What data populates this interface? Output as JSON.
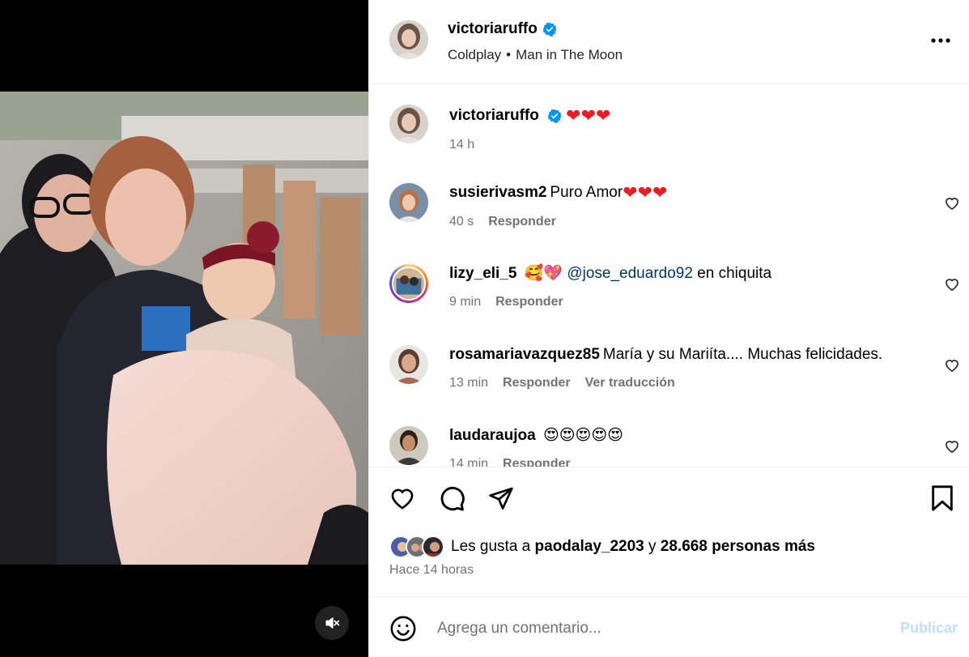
{
  "post": {
    "author": "victoriaruffo",
    "verified": true,
    "audio": {
      "artist": "Coldplay",
      "separator": "•",
      "song": "Man in The Moon"
    },
    "caption": {
      "user": "victoriaruffo",
      "text": "❤❤❤",
      "time": "14 h"
    }
  },
  "comments": [
    {
      "user": "susierivasm2",
      "text": "Puro Amor",
      "hearts": "❤❤❤",
      "time": "40 s",
      "reply": "Responder",
      "translate": ""
    },
    {
      "user": "lizy_eli_5",
      "emoji": "🥰💖",
      "mention": "@jose_eduardo92",
      "text": "en chiquita",
      "time": "9 min",
      "reply": "Responder",
      "translate": ""
    },
    {
      "user": "rosamariavazquez85",
      "text": "María y su Mariíta.... Muchas felicidades.",
      "time": "13 min",
      "reply": "Responder",
      "translate": "Ver traducción"
    },
    {
      "user": "laudaraujoa",
      "text": "😍😍😍😍😍",
      "time": "14 min",
      "reply": "Responder",
      "translate": ""
    }
  ],
  "likes": {
    "prefix": "Les gusta a",
    "user": "paodalay_2203",
    "conj": "y",
    "count": "28.668 personas más"
  },
  "time_ago": "Hace 14 horas",
  "composer": {
    "placeholder": "Agrega un comentario...",
    "post_label": "Publicar"
  },
  "icons": {
    "like": "heart-icon",
    "comment": "comment-icon",
    "share": "paper-plane-icon",
    "save": "bookmark-icon",
    "more": "more-options-icon",
    "mute": "speaker-muted-icon",
    "emoji": "emoji-icon"
  },
  "colors": {
    "verified": "#0095f6",
    "mention": "#00376b",
    "post_disabled": "#c0dffd",
    "meta": "#737373"
  }
}
